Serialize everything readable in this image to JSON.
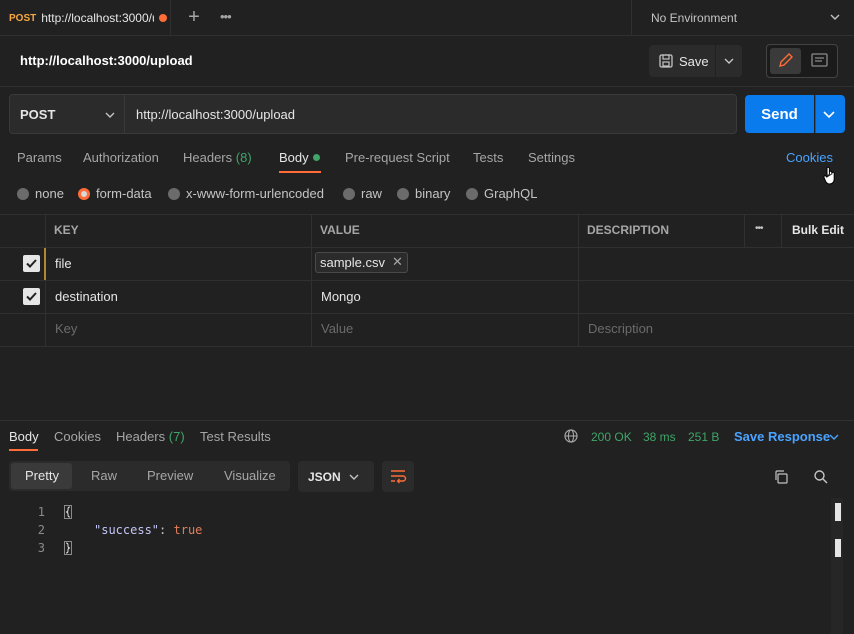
{
  "tab": {
    "method": "POST",
    "url": "http://localhost:3000/upload"
  },
  "environment": "No Environment",
  "title": "http://localhost:3000/upload",
  "toolbar": {
    "save_label": "Save"
  },
  "request": {
    "method": "POST",
    "url": "http://localhost:3000/upload",
    "send_label": "Send"
  },
  "request_tabs": {
    "params": "Params",
    "authorization": "Authorization",
    "headers": "Headers",
    "headers_count": "(8)",
    "body": "Body",
    "pre_request": "Pre-request Script",
    "tests": "Tests",
    "settings": "Settings",
    "cookies": "Cookies"
  },
  "body_types": [
    "none",
    "form-data",
    "x-www-form-urlencoded",
    "raw",
    "binary",
    "GraphQL"
  ],
  "body_type_selected": "form-data",
  "table": {
    "headers": {
      "key": "KEY",
      "value": "VALUE",
      "description": "DESCRIPTION",
      "bulk_edit": "Bulk Edit"
    },
    "rows": [
      {
        "key": "file",
        "value": "sample.csv",
        "description": "",
        "checked": true
      },
      {
        "key": "destination",
        "value": "Mongo",
        "description": "",
        "checked": true
      }
    ],
    "placeholders": {
      "key": "Key",
      "value": "Value",
      "description": "Description"
    }
  },
  "response": {
    "tabs": {
      "body": "Body",
      "cookies": "Cookies",
      "headers": "Headers",
      "headers_count": "(7)",
      "test_results": "Test Results"
    },
    "status": "200 OK",
    "time": "38 ms",
    "size": "251 B",
    "save_response": "Save Response",
    "formats": [
      "Pretty",
      "Raw",
      "Preview",
      "Visualize"
    ],
    "format_selected": "Pretty",
    "language": "JSON",
    "lines": [
      "1",
      "2",
      "3"
    ],
    "json_key": "\"success\"",
    "json_colon": ":",
    "json_value": "true"
  },
  "colors": {
    "accent": "#ff6c37",
    "primary": "#097bed",
    "success": "#3fa568",
    "link": "#4aa3ff",
    "method": "#f7a841"
  }
}
